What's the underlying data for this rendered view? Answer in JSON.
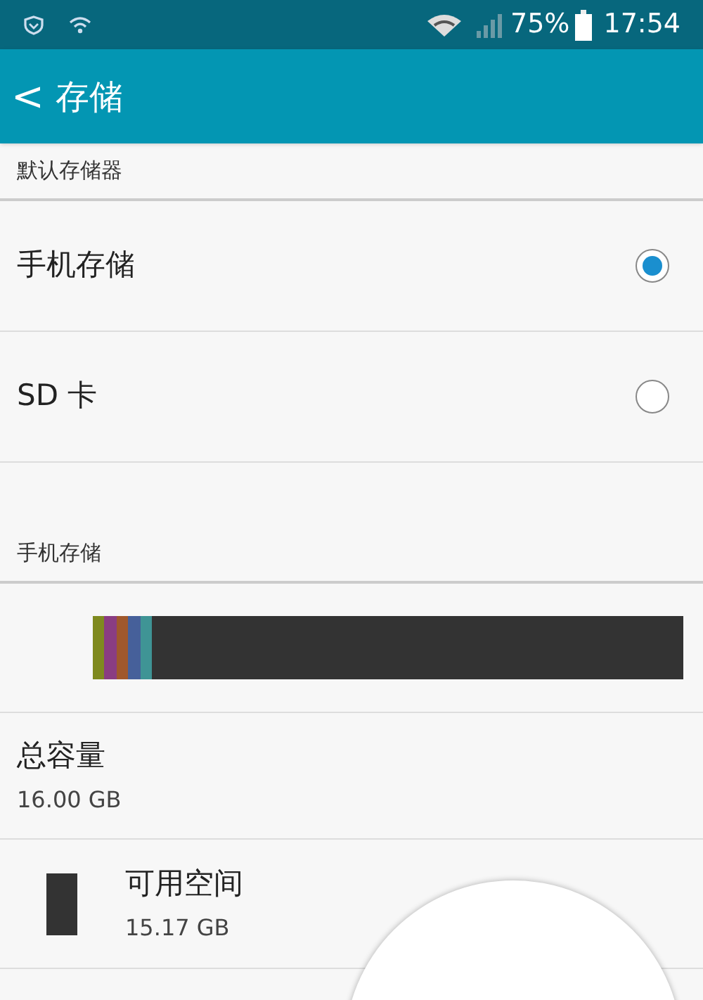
{
  "status_bar": {
    "battery": "75%",
    "time": "17:54"
  },
  "app_bar": {
    "back": "<",
    "title": "存储"
  },
  "sections": [
    {
      "header": "默认存储器",
      "options": [
        {
          "label": "手机存储",
          "selected": true
        },
        {
          "label": "SD 卡",
          "selected": false
        }
      ]
    },
    {
      "header": "手机存储",
      "usage_bar": {
        "segments": [
          {
            "color": "#7f8a1f"
          },
          {
            "color": "#8a3d82"
          },
          {
            "color": "#a0582c"
          },
          {
            "color": "#46609a"
          },
          {
            "color": "#3f9495"
          }
        ]
      },
      "items": [
        {
          "kind": "total",
          "label": "总容量",
          "value": "16.00 GB"
        },
        {
          "kind": "legend",
          "label": "可用空间",
          "value": "15.17 GB",
          "color": "#333333"
        }
      ]
    }
  ]
}
